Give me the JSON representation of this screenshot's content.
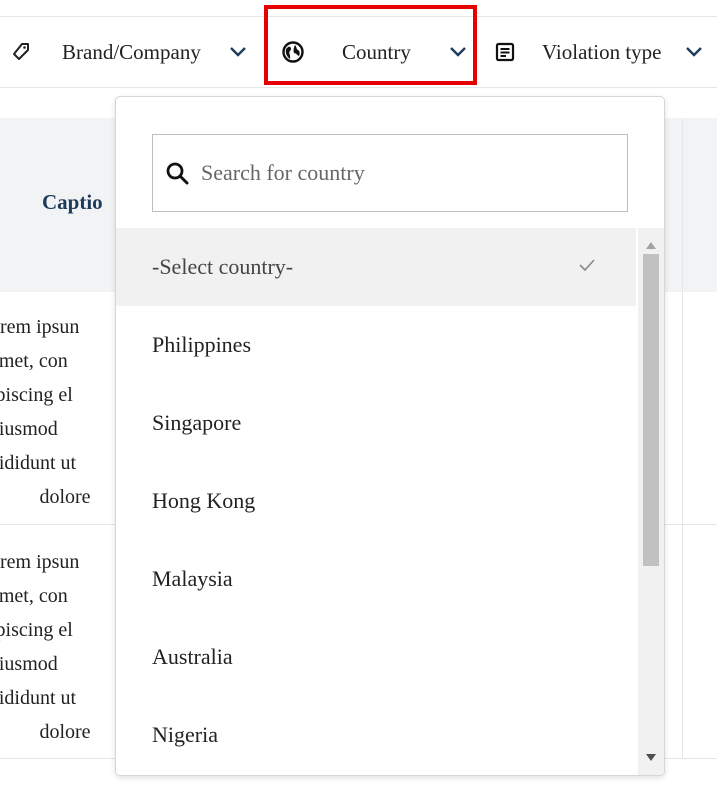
{
  "filters": {
    "brand_label": "Brand/Company",
    "country_label": "Country",
    "violation_label": "Violation type",
    "brand_icon": "tag-icon",
    "country_icon": "globe-icon",
    "violation_icon": "document-icon"
  },
  "table": {
    "caption_header": "Captio",
    "rows": [
      {
        "lines": [
          "orem ipsun",
          "amet, con",
          "ipiscing el",
          "eiusmod",
          "cididunt ut",
          "dolore"
        ]
      },
      {
        "lines": [
          "orem ipsun",
          "amet, con",
          "ipiscing el",
          "eiusmod",
          "cididunt ut",
          "dolore"
        ]
      }
    ]
  },
  "dropdown": {
    "search_placeholder": "Search for country",
    "options": [
      {
        "label": "-Select country-",
        "selected": true
      },
      {
        "label": "Philippines",
        "selected": false
      },
      {
        "label": "Singapore",
        "selected": false
      },
      {
        "label": "Hong Kong",
        "selected": false
      },
      {
        "label": "Malaysia",
        "selected": false
      },
      {
        "label": "Australia",
        "selected": false
      },
      {
        "label": "Nigeria",
        "selected": false
      }
    ]
  },
  "colors": {
    "highlight": "#e60000",
    "header_text": "#1f3b5c",
    "selected_bg": "#f1f1f1"
  }
}
